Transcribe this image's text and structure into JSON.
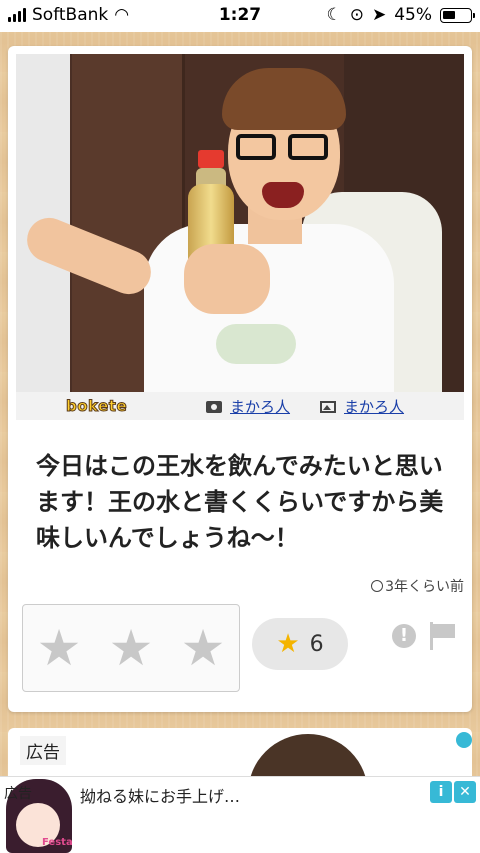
{
  "status_bar": {
    "carrier": "SoftBank",
    "time": "1:27",
    "battery_percent": "45%",
    "battery_level": 0.45
  },
  "post": {
    "site_logo": "bokete",
    "photo_credit": "まかろ人",
    "image_credit": "まかろ人",
    "caption": "今日はこの王水を飲んでみたいと思います！王の水と書くくらいですから美味しいんでしょうね〜！",
    "timestamp": "3年くらい前",
    "favorite_count": "6",
    "star_color": "#f4b400"
  },
  "next_card": {
    "ad_label": "広告"
  },
  "banner_ad": {
    "tag": "広告",
    "title": "拗ねる妹にお手上げ…",
    "thumb_text": "Festa",
    "info_label": "i",
    "close_label": "✕"
  }
}
